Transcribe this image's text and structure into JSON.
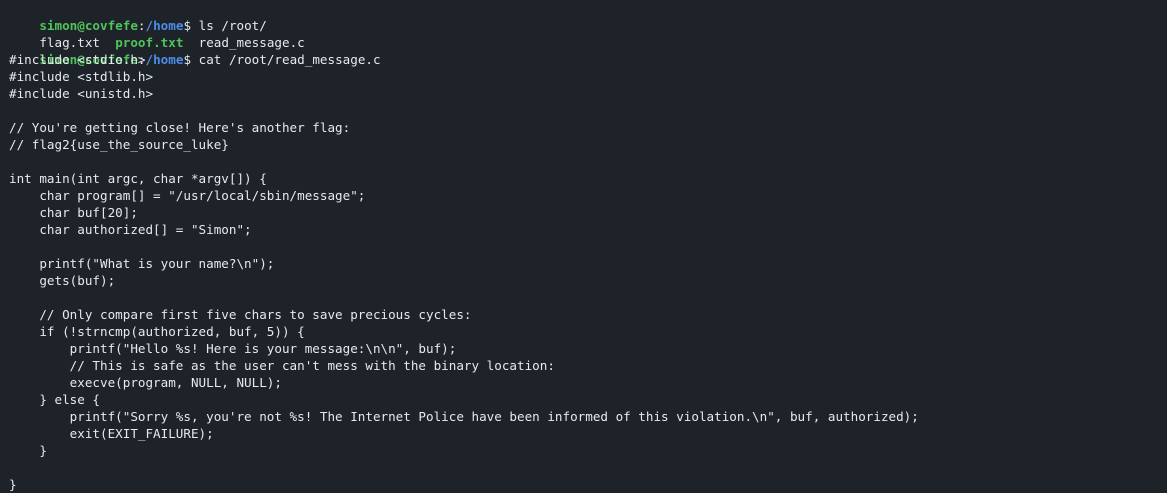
{
  "prompt": {
    "user_host": "simon@covfefe",
    "separator": ":",
    "path": "/home",
    "dollar": "$ "
  },
  "commands": [
    "ls /root/",
    "cat /root/read_message.c"
  ],
  "ls_output": [
    {
      "name": "flag.txt",
      "type": "regular"
    },
    {
      "name": "proof.txt",
      "type": "executable"
    },
    {
      "name": "read_message.c",
      "type": "regular"
    }
  ],
  "file_lines": [
    "#include <stdio.h>",
    "#include <stdlib.h>",
    "#include <unistd.h>",
    "",
    "// You're getting close! Here's another flag:",
    "// flag2{use_the_source_luke}",
    "",
    "int main(int argc, char *argv[]) {",
    "    char program[] = \"/usr/local/sbin/message\";",
    "    char buf[20];",
    "    char authorized[] = \"Simon\";",
    "",
    "    printf(\"What is your name?\\n\");",
    "    gets(buf);",
    "",
    "    // Only compare first five chars to save precious cycles:",
    "    if (!strncmp(authorized, buf, 5)) {",
    "        printf(\"Hello %s! Here is your message:\\n\\n\", buf);",
    "        // This is safe as the user can't mess with the binary location:",
    "        execve(program, NULL, NULL);",
    "    } else {",
    "        printf(\"Sorry %s, you're not %s! The Internet Police have been informed of this violation.\\n\", buf, authorized);",
    "        exit(EXIT_FAILURE);",
    "    }",
    "",
    "}"
  ],
  "colors": {
    "background": "#1e2229",
    "foreground": "#e6e9ee",
    "prompt_user": "#4ec45a",
    "prompt_path": "#4c8de8",
    "executable": "#4ec45a"
  }
}
